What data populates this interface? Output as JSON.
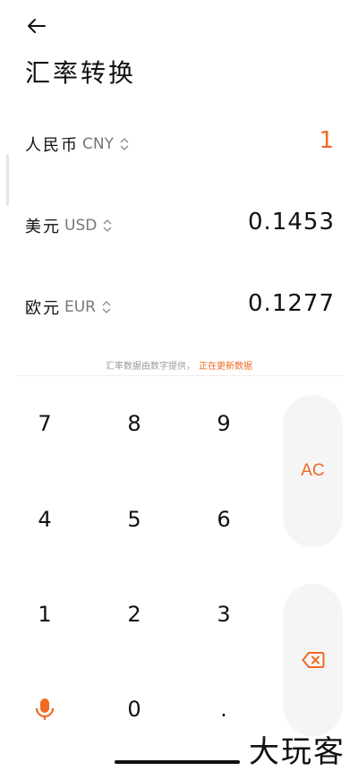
{
  "header": {
    "title": "汇率转换"
  },
  "currencies": [
    {
      "name": "人民币",
      "code": "CNY",
      "value": "1"
    },
    {
      "name": "美元",
      "code": "USD",
      "value": "0.1453"
    },
    {
      "name": "欧元",
      "code": "EUR",
      "value": "0.1277"
    }
  ],
  "note": {
    "text": "汇率数据由数字提供，",
    "updating": "正在更新数据"
  },
  "keypad": {
    "keys": [
      "7",
      "8",
      "9",
      "4",
      "5",
      "6",
      "1",
      "2",
      "3",
      "0",
      "."
    ],
    "ac": "AC"
  },
  "watermark": "大玩客",
  "colors": {
    "accent": "#f06a24",
    "side_button_bg": "#f5f5f5"
  },
  "icons": [
    "back-arrow-icon",
    "sort-updown-icon",
    "microphone-icon",
    "backspace-icon"
  ]
}
